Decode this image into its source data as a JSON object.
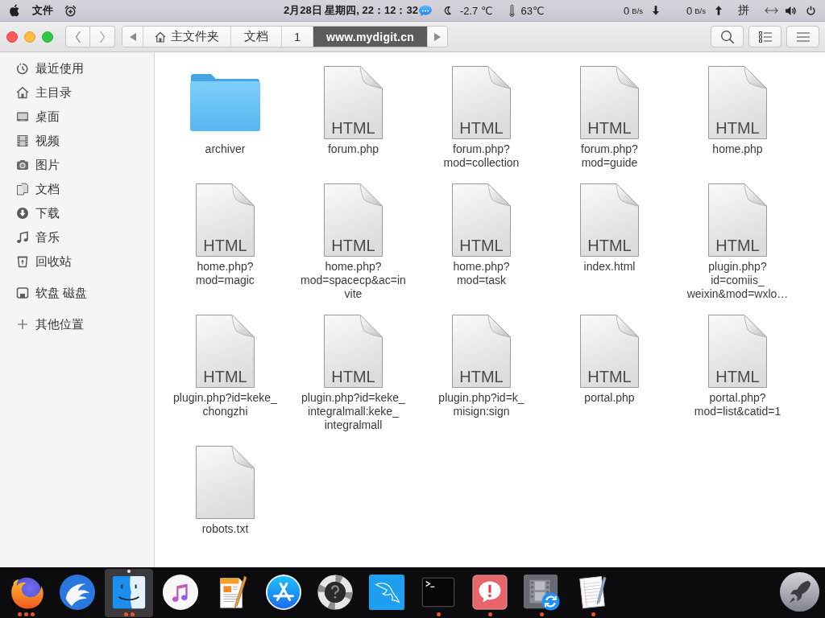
{
  "top_bar": {
    "menu_label": "文件",
    "clock": "2月28日 星期四, 22：12：32",
    "outdoor_temperature": "-2.7 ℃",
    "cpu_temperature": "63℃",
    "download_speed": {
      "value": "0",
      "unit": "B/s"
    },
    "upload_speed": {
      "value": "0",
      "unit": "B/s"
    },
    "input_method": "拼"
  },
  "toolbar": {
    "path": [
      {
        "kind": "home",
        "label": "主文件夹",
        "selected": false
      },
      {
        "kind": "folder",
        "label": "文档",
        "selected": false
      },
      {
        "kind": "folder",
        "label": "1",
        "selected": false
      },
      {
        "kind": "folder",
        "label": "www.mydigit.cn",
        "selected": true
      }
    ]
  },
  "sidebar": {
    "sections": [
      [
        {
          "kind": "recent",
          "label": "最近使用",
          "selected": false
        },
        {
          "kind": "home",
          "label": "主目录",
          "selected": false
        },
        {
          "kind": "desktop",
          "label": "桌面",
          "selected": false
        },
        {
          "kind": "videos",
          "label": "视频",
          "selected": false
        },
        {
          "kind": "pictures",
          "label": "图片",
          "selected": false
        },
        {
          "kind": "documents",
          "label": "文档",
          "selected": false
        },
        {
          "kind": "downloads",
          "label": "下载",
          "selected": false
        },
        {
          "kind": "music",
          "label": "音乐",
          "selected": false
        },
        {
          "kind": "trash",
          "label": "回收站",
          "selected": false
        }
      ],
      [
        {
          "kind": "drive",
          "label": "软盘 磁盘",
          "selected": false
        }
      ],
      [
        {
          "kind": "other",
          "label": "其他位置",
          "selected": false
        }
      ]
    ]
  },
  "files": [
    {
      "kind": "folder",
      "name_lines": [
        "archiver"
      ],
      "selected": false
    },
    {
      "kind": "html",
      "type_label": "HTML",
      "name_lines": [
        "forum.php"
      ],
      "selected": false
    },
    {
      "kind": "html",
      "type_label": "HTML",
      "name_lines": [
        "forum.php?",
        "mod=collection"
      ],
      "selected": false
    },
    {
      "kind": "html",
      "type_label": "HTML",
      "name_lines": [
        "forum.php?",
        "mod=guide"
      ],
      "selected": false
    },
    {
      "kind": "html",
      "type_label": "HTML",
      "name_lines": [
        "home.php"
      ],
      "selected": false
    },
    {
      "kind": "html",
      "type_label": "HTML",
      "name_lines": [
        "home.php?",
        "mod=magic"
      ],
      "selected": false
    },
    {
      "kind": "html",
      "type_label": "HTML",
      "name_lines": [
        "home.php?",
        "mod=spacecp&ac=in",
        "vite"
      ],
      "selected": false
    },
    {
      "kind": "html",
      "type_label": "HTML",
      "name_lines": [
        "home.php?",
        "mod=task"
      ],
      "selected": false
    },
    {
      "kind": "html",
      "type_label": "HTML",
      "name_lines": [
        "index.html"
      ],
      "selected": false
    },
    {
      "kind": "html",
      "type_label": "HTML",
      "name_lines": [
        "plugin.php?",
        "id=comiis_",
        "weixin&mod=wxlo…"
      ],
      "selected": false
    },
    {
      "kind": "html",
      "type_label": "HTML",
      "name_lines": [
        "plugin.php?id=keke_",
        "chongzhi"
      ],
      "selected": false
    },
    {
      "kind": "html",
      "type_label": "HTML",
      "name_lines": [
        "plugin.php?id=keke_",
        "integralmall:keke_",
        "integralmall"
      ],
      "selected": false
    },
    {
      "kind": "html",
      "type_label": "HTML",
      "name_lines": [
        "plugin.php?id=k_",
        "misign:sign"
      ],
      "selected": false
    },
    {
      "kind": "html",
      "type_label": "HTML",
      "name_lines": [
        "portal.php"
      ],
      "selected": false
    },
    {
      "kind": "html",
      "type_label": "HTML",
      "name_lines": [
        "portal.php?",
        "mod=list&catid=1"
      ],
      "selected": false
    },
    {
      "kind": "text",
      "name_lines": [
        "robots.txt"
      ],
      "selected": false
    }
  ],
  "dock": {
    "apps": [
      {
        "kind": "fox",
        "selected": false,
        "dots": [
          {
            "kind": "running"
          },
          {
            "kind": "running"
          },
          {
            "kind": "running"
          }
        ]
      },
      {
        "kind": "eagle",
        "selected": false
      },
      {
        "kind": "finder",
        "selected": true,
        "dots": [
          {
            "kind": "running"
          },
          {
            "kind": "running"
          }
        ]
      },
      {
        "kind": "music",
        "selected": false
      },
      {
        "kind": "pages",
        "selected": false
      },
      {
        "kind": "store",
        "selected": false
      },
      {
        "kind": "help",
        "selected": false
      },
      {
        "kind": "dolphin",
        "selected": false
      },
      {
        "kind": "terminal",
        "selected": false,
        "dots": [
          {
            "kind": "running"
          }
        ]
      },
      {
        "kind": "alert",
        "selected": false,
        "dots": [
          {
            "kind": "running"
          }
        ]
      },
      {
        "kind": "video",
        "selected": false,
        "dots": [
          {
            "kind": "running"
          }
        ]
      },
      {
        "kind": "notes",
        "selected": false,
        "dots": [
          {
            "kind": "running"
          }
        ]
      }
    ],
    "launcher": {
      "kind": "rocket",
      "selected": false
    }
  }
}
